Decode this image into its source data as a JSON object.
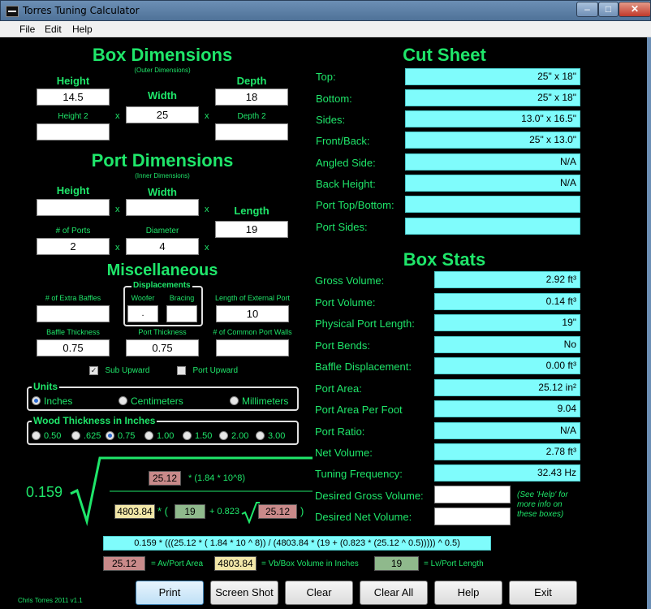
{
  "window": {
    "title": "Torres Tuning Calculator"
  },
  "menu": [
    "File",
    "Edit",
    "Help"
  ],
  "box_dimensions": {
    "heading": "Box Dimensions",
    "subheading": "(Outer Dimensions)",
    "height_label": "Height",
    "height_value": "14.5",
    "width_label": "Width",
    "width_value": "25",
    "depth_label": "Depth",
    "depth_value": "18",
    "height2_label": "Height 2",
    "height2_value": "",
    "depth2_label": "Depth 2",
    "depth2_value": "",
    "x_sep": "x"
  },
  "port_dimensions": {
    "heading": "Port Dimensions",
    "subheading": "(Inner Dimensions)",
    "height_label": "Height",
    "height_value": "",
    "width_label": "Width",
    "width_value": "",
    "length_label": "Length",
    "length_value": "19",
    "ports_label": "# of Ports",
    "ports_value": "2",
    "diameter_label": "Diameter",
    "diameter_value": "4"
  },
  "misc": {
    "heading": "Miscellaneous",
    "extra_baffles_label": "# of Extra Baffles",
    "extra_baffles_value": "",
    "displacements_title": "Displacements",
    "woofer_label": "Woofer",
    "woofer_value": ".",
    "bracing_label": "Bracing",
    "bracing_value": "",
    "ext_port_label": "Length of External Port",
    "ext_port_value": "10",
    "baffle_thickness_label": "Baffle Thickness",
    "baffle_thickness_value": "0.75",
    "port_thickness_label": "Port Thickness",
    "port_thickness_value": "0.75",
    "common_walls_label": "# of Common Port Walls",
    "common_walls_value": "",
    "sub_upward_label": "Sub Upward",
    "sub_upward_checked": "✓",
    "port_upward_label": "Port Upward"
  },
  "units": {
    "title": "Units",
    "options": [
      "Inches",
      "Centimeters",
      "Millimeters"
    ],
    "selected": "Inches"
  },
  "wood": {
    "title": "Wood Thickness in Inches",
    "options": [
      "0.50",
      ".625",
      "0.75",
      "1.00",
      "1.50",
      "2.00",
      "3.00"
    ],
    "selected": "0.75"
  },
  "cut_sheet": {
    "heading": "Cut Sheet",
    "rows": [
      {
        "label": "Top:",
        "value": "25\" x 18\""
      },
      {
        "label": "Bottom:",
        "value": "25\" x 18\""
      },
      {
        "label": "Sides:",
        "value": "13.0\" x 16.5\""
      },
      {
        "label": "Front/Back:",
        "value": "25\" x 13.0\""
      },
      {
        "label": "Angled Side:",
        "value": "N/A"
      },
      {
        "label": "Back Height:",
        "value": "N/A"
      },
      {
        "label": "Port Top/Bottom:",
        "value": ""
      },
      {
        "label": "Port Sides:",
        "value": ""
      }
    ]
  },
  "box_stats": {
    "heading": "Box Stats",
    "rows": [
      {
        "label": "Gross Volume:",
        "value": "2.92 ft³"
      },
      {
        "label": "Port Volume:",
        "value": "0.14 ft³"
      },
      {
        "label": "Physical Port Length:",
        "value": "19\""
      },
      {
        "label": "Port Bends:",
        "value": "No"
      },
      {
        "label": "Baffle Displacement:",
        "value": "0.00 ft³"
      },
      {
        "label": "Port Area:",
        "value": "25.12 in²"
      },
      {
        "label": "Port Area Per Foot",
        "value": "9.04"
      },
      {
        "label": "Port Ratio:",
        "value": "N/A"
      },
      {
        "label": "Net Volume:",
        "value": "2.78 ft³"
      },
      {
        "label": "Tuning Frequency:",
        "value": "32.43 Hz"
      }
    ],
    "desired_gross_label": "Desired Gross Volume:",
    "desired_gross_value": "",
    "desired_net_label": "Desired Net Volume:",
    "desired_net_value": "",
    "help_note": "(See 'Help' for more info on these boxes)"
  },
  "formula": {
    "constant": "0.159",
    "av": "25.12",
    "numerator_text": "* (1.84 * 10^8)",
    "vb": "4803.84",
    "mul_paren": "* (",
    "lv": "19",
    "plus_const": "+ 0.823",
    "av2": "25.12",
    "close_paren": ")",
    "full_expression": "0.159 * (((25.12 * ( 1.84 * 10 ^ 8)) / (4803.84 * (19 + (0.823 * (25.12 ^ 0.5))))) ^ 0.5)",
    "legend_av_value": "25.12",
    "legend_av_label": "= Av/Port Area",
    "legend_vb_value": "4803.84",
    "legend_vb_label": "= Vb/Box Volume in Inches",
    "legend_lv_value": "19",
    "legend_lv_label": "= Lv/Port Length"
  },
  "footer": {
    "credit": "Chris Torres 2011 v1.1",
    "buttons": [
      "Print",
      "Screen Shot",
      "Clear",
      "Clear All",
      "Help",
      "Exit"
    ]
  }
}
